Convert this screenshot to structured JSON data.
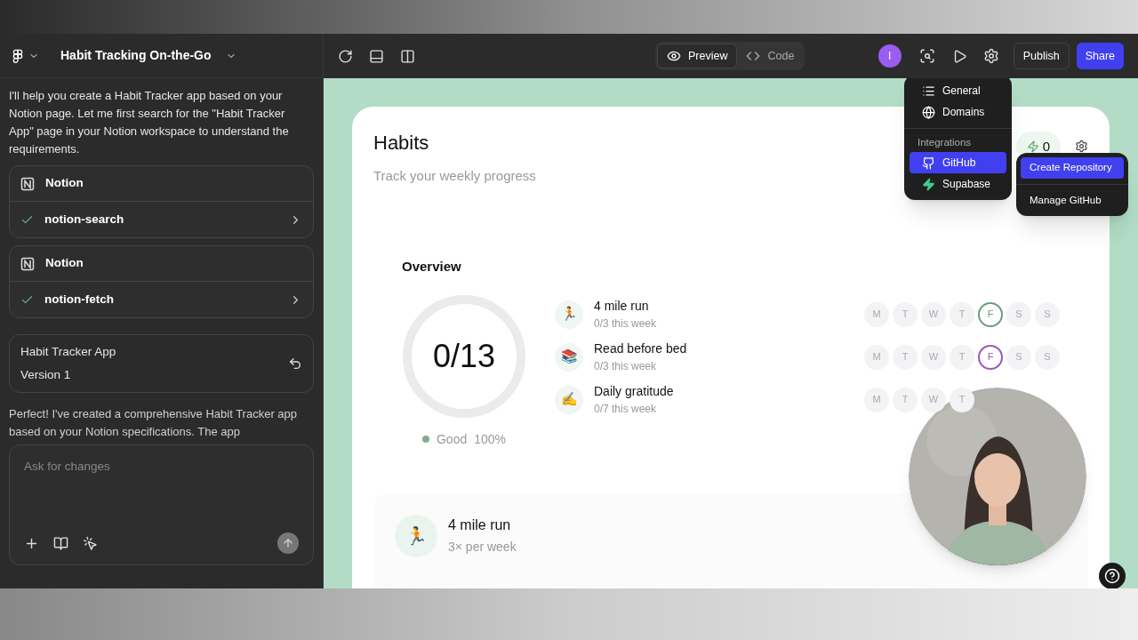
{
  "project": {
    "title": "Habit Tracking On-the-Go"
  },
  "chat": {
    "intro": "I'll help you create a Habit Tracker app based on your Notion page. Let me first search for the \"Habit Tracker App\" page in your Notion workspace to understand the requirements.",
    "tools": [
      {
        "service": "Notion",
        "call": "notion-search",
        "done": true
      },
      {
        "service": "Notion",
        "call": "notion-fetch",
        "done": true
      }
    ],
    "version": {
      "name": "Habit Tracker App",
      "label": "Version 1"
    },
    "reply": "Perfect! I've created a comprehensive Habit Tracker app based on your Notion specifications. The app",
    "input": {
      "placeholder": "Ask for changes"
    }
  },
  "toolbar": {
    "views": [
      {
        "label": "Preview",
        "selected": true
      },
      {
        "label": "Code",
        "selected": false
      }
    ],
    "avatar": "I",
    "publish": "Publish",
    "share": "Share"
  },
  "settings_menu": {
    "items": [
      {
        "label": "General",
        "selected": false
      },
      {
        "label": "Domains",
        "selected": false
      }
    ],
    "section": "Integrations",
    "integrations": [
      {
        "label": "GitHub",
        "selected": true
      },
      {
        "label": "Supabase",
        "selected": false
      }
    ],
    "submenu": [
      {
        "label": "Create Repository",
        "selected": true
      },
      {
        "label": "Manage GitHub",
        "selected": false
      }
    ]
  },
  "app": {
    "title": "Habits",
    "subtitle": "Track your weekly progress",
    "streak": "0",
    "overview": {
      "title": "Overview",
      "progress": "0/13",
      "status": "Good",
      "percent": "100%",
      "habits": [
        {
          "name": "4 mile run",
          "count": "0/3 this week",
          "emoji": "🏃",
          "color": "#6a9e80",
          "days": [
            {
              "d": "M",
              "today": false
            },
            {
              "d": "T",
              "today": false
            },
            {
              "d": "W",
              "today": false
            },
            {
              "d": "T",
              "today": false
            },
            {
              "d": "F",
              "today": true
            },
            {
              "d": "S",
              "today": false
            },
            {
              "d": "S",
              "today": false
            }
          ]
        },
        {
          "name": "Read before bed",
          "count": "0/3 this week",
          "emoji": "📚",
          "color": "#9b59b6",
          "days": [
            {
              "d": "M",
              "today": false
            },
            {
              "d": "T",
              "today": false
            },
            {
              "d": "W",
              "today": false
            },
            {
              "d": "T",
              "today": false
            },
            {
              "d": "F",
              "today": true
            },
            {
              "d": "S",
              "today": false
            },
            {
              "d": "S",
              "today": false
            }
          ]
        },
        {
          "name": "Daily gratitude",
          "count": "0/7 this week",
          "emoji": "✍️",
          "days": [
            {
              "d": "M",
              "today": false
            },
            {
              "d": "T",
              "today": false
            },
            {
              "d": "W",
              "today": false
            },
            {
              "d": "T",
              "today": false
            }
          ]
        }
      ]
    },
    "detail": {
      "name": "4 mile run",
      "frequency": "3× per week",
      "emoji": "🏃"
    }
  }
}
